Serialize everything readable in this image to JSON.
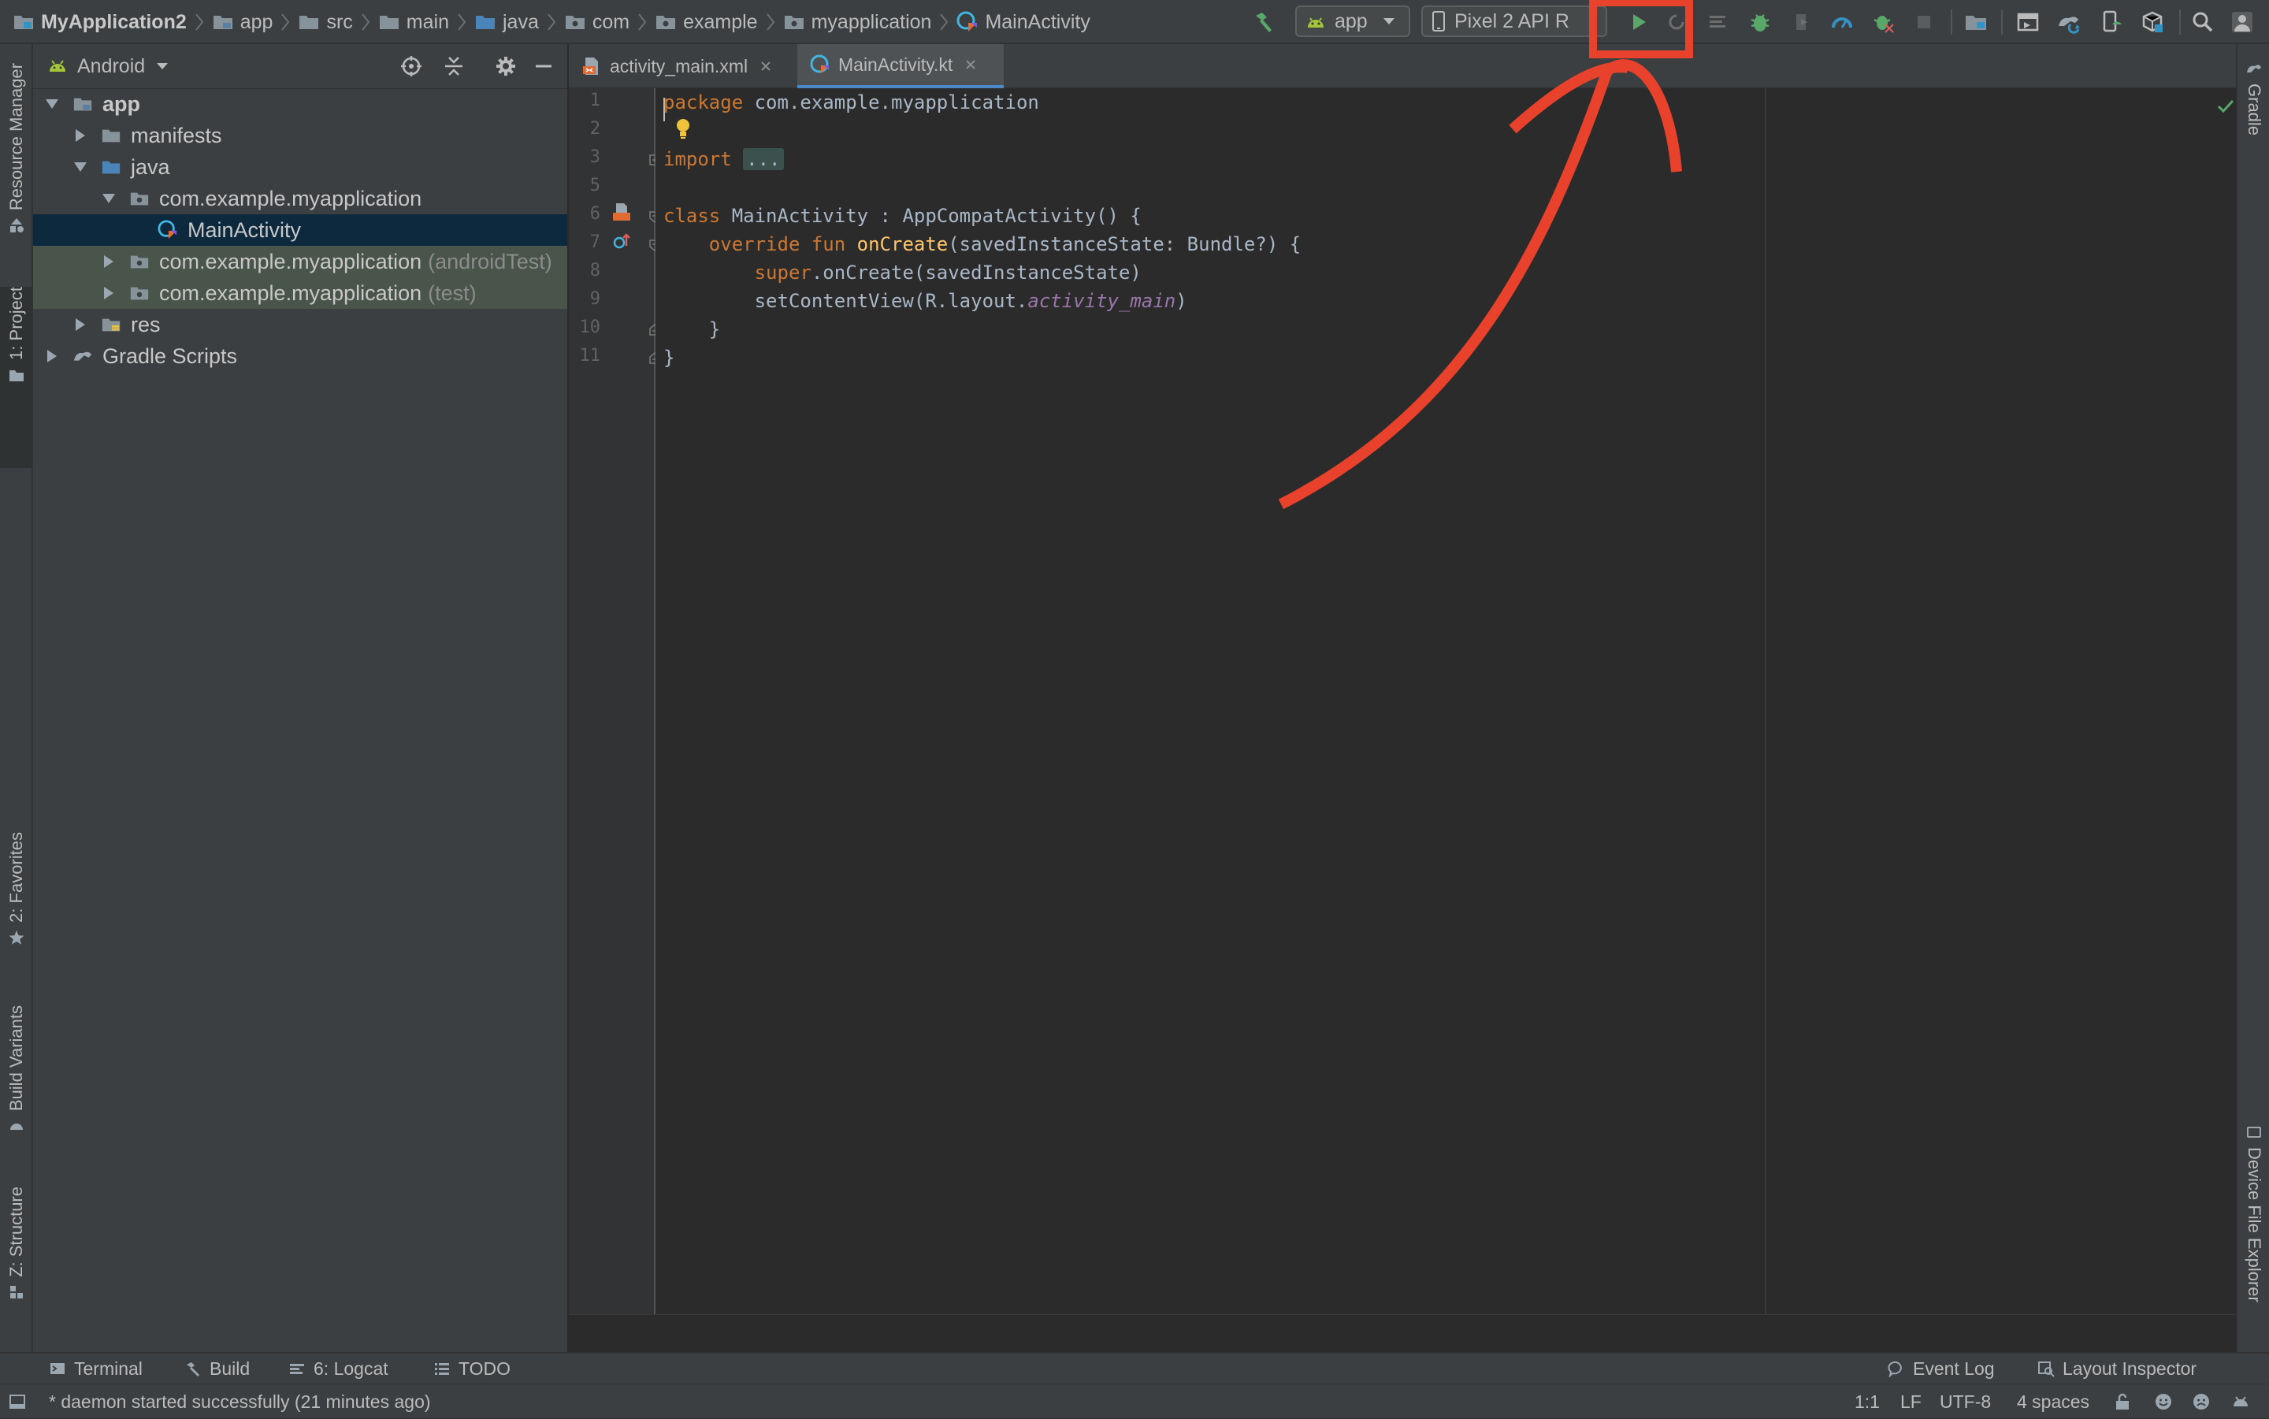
{
  "breadcrumb": [
    {
      "label": "MyApplication2",
      "icon": "project-folder-icon"
    },
    {
      "label": "app",
      "icon": "module-folder-icon"
    },
    {
      "label": "src",
      "icon": "folder-icon"
    },
    {
      "label": "main",
      "icon": "folder-icon"
    },
    {
      "label": "java",
      "icon": "source-folder-icon"
    },
    {
      "label": "com",
      "icon": "package-icon"
    },
    {
      "label": "example",
      "icon": "package-icon"
    },
    {
      "label": "myapplication",
      "icon": "package-icon"
    },
    {
      "label": "MainActivity",
      "icon": "kotlin-class-icon"
    }
  ],
  "toolbar": {
    "run_config": "app",
    "device": "Pixel 2 API R",
    "icons": [
      "hammer-icon",
      "run-icon",
      "apply-changes-icon",
      "coverage-icon",
      "debug-icon",
      "profile-icon",
      "attach-debugger-icon",
      "stop-icon",
      "project-structure-icon",
      "avd-manager-icon",
      "sync-gradle-icon",
      "sdk-manager-icon",
      "search-icon"
    ]
  },
  "left_strip": {
    "resource_manager": "Resource Manager",
    "project": "1: Project",
    "favorites": "2: Favorites",
    "build_variants": "Build Variants",
    "structure": "Z: Structure"
  },
  "right_strip": {
    "gradle": "Gradle",
    "device_file_explorer": "Device File Explorer"
  },
  "project_panel": {
    "view_mode": "Android",
    "tree": [
      {
        "label": "app",
        "suffix": "",
        "level": 0,
        "expanded": true,
        "icon": "module-folder-icon",
        "bold": true
      },
      {
        "label": "manifests",
        "suffix": "",
        "level": 1,
        "expanded": false,
        "icon": "folder-icon"
      },
      {
        "label": "java",
        "suffix": "",
        "level": 1,
        "expanded": true,
        "icon": "source-folder-icon"
      },
      {
        "label": "com.example.myapplication",
        "suffix": "",
        "level": 2,
        "expanded": true,
        "icon": "package-icon"
      },
      {
        "label": "MainActivity",
        "suffix": "",
        "level": 3,
        "leaf": true,
        "icon": "kotlin-class-icon",
        "selected": true
      },
      {
        "label": "com.example.myapplication",
        "suffix": "(androidTest)",
        "level": 2,
        "expanded": false,
        "icon": "package-icon",
        "tinted": true
      },
      {
        "label": "com.example.myapplication",
        "suffix": "(test)",
        "level": 2,
        "expanded": false,
        "icon": "package-icon",
        "tinted": true
      },
      {
        "label": "res",
        "suffix": "",
        "level": 1,
        "expanded": false,
        "icon": "res-folder-icon"
      },
      {
        "label": "Gradle Scripts",
        "suffix": "",
        "level": 0,
        "expanded": false,
        "icon": "gradle-icon"
      }
    ]
  },
  "editor": {
    "tabs": [
      {
        "label": "activity_main.xml",
        "active": false,
        "icon": "xml-file-icon"
      },
      {
        "label": "MainActivity.kt",
        "active": true,
        "icon": "kotlin-file-icon"
      }
    ],
    "line_numbers": [
      "1",
      "2",
      "3",
      "5",
      "6",
      "7",
      "8",
      "9",
      "10",
      "11"
    ],
    "code": {
      "l1_kw": "package",
      "l1_rest": " com.example.myapplication",
      "l3_kw": "import",
      "l3_fold": "...",
      "l6_kw": "class",
      "l6_rest": " MainActivity : AppCompatActivity() {",
      "l7_indent": "    ",
      "l7_kw": "override fun",
      "l7_fn": "onCreate",
      "l7_rest": "(savedInstanceState: Bundle?) {",
      "l8_indent": "        ",
      "l8_kw": "super",
      "l8_rest": ".onCreate(savedInstanceState)",
      "l9_indent": "        ",
      "l9_pre": "setContentView(R.layout.",
      "l9_it": "activity_main",
      "l9_post": ")",
      "l10": "    }",
      "l11": "}"
    }
  },
  "bottom_bar": {
    "terminal": "Terminal",
    "build": "Build",
    "logcat": "6: Logcat",
    "todo": "TODO",
    "event_log": "Event Log",
    "layout_inspector": "Layout Inspector"
  },
  "status_bar": {
    "message": "* daemon started successfully (21 minutes ago)",
    "position": "1:1",
    "line_separator": "LF",
    "encoding": "UTF-8",
    "indent": "4 spaces"
  },
  "colors": {
    "annotation": "#e8412c",
    "run": "#59a869",
    "accent": "#4a88c7"
  }
}
